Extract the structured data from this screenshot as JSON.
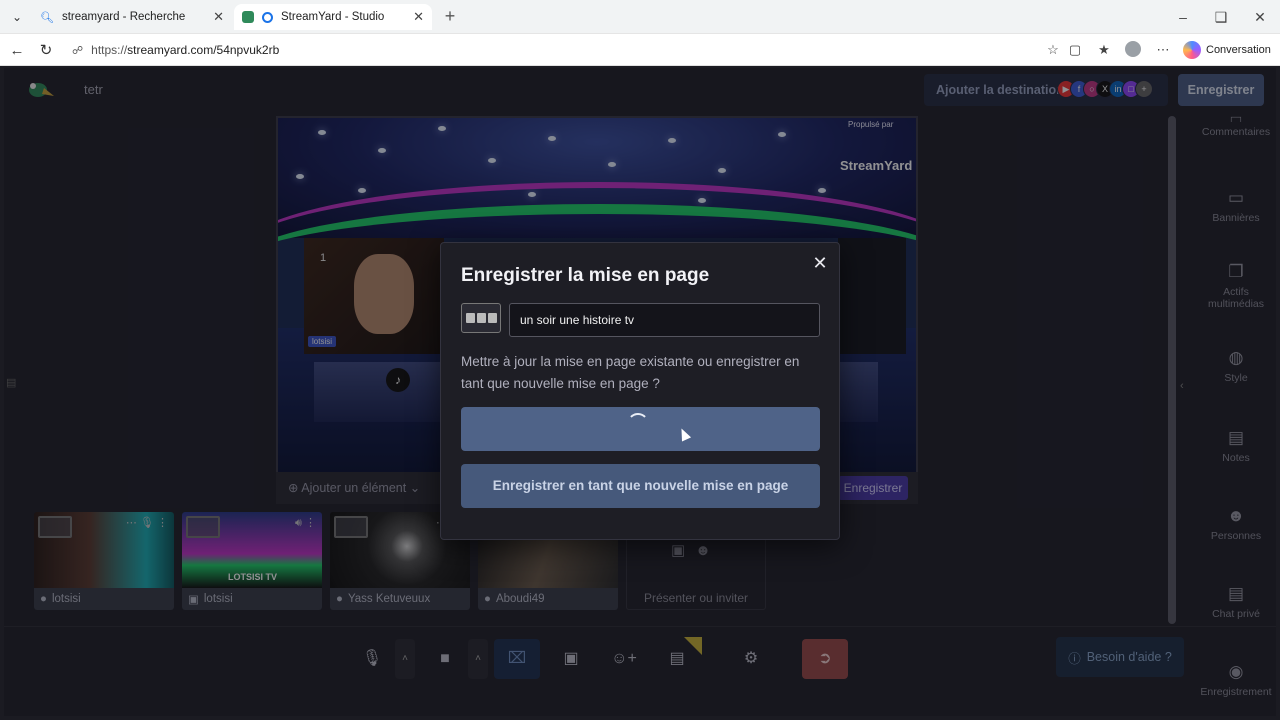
{
  "browser": {
    "tabs": [
      {
        "label": "streamyard - Recherche",
        "icon": "search-icon"
      },
      {
        "label": "StreamYard - Studio",
        "icon": "streamyard-favicon"
      }
    ],
    "url_prefix": "https://",
    "url_main": "streamyard.com/54npvuk2rb",
    "conversation_label": "Conversation"
  },
  "app": {
    "project_name": "tetr",
    "add_destination_label": "Ajouter la destination",
    "destination_icons": [
      "youtube-icon",
      "facebook-icon",
      "instagram-icon",
      "x-icon",
      "linkedin-icon",
      "twitch-icon",
      "plus-icon"
    ],
    "header_save_label": "Enregistrer",
    "stage": {
      "slot_number": "1",
      "name_tag": "lotsisi",
      "powered_by": "Propulsé par",
      "brand": "StreamYard"
    },
    "add_element_label": "Ajouter un élément",
    "stage_save_label": "Enregistrer",
    "thumbnails": [
      {
        "name": "lotsisi",
        "kind": "camera"
      },
      {
        "name": "lotsisi",
        "kind": "screen",
        "overlay_text": "LOTSISI TV"
      },
      {
        "name": "Yass Ketuveuux",
        "kind": "camera"
      },
      {
        "name": "Aboudi49",
        "kind": "camera"
      }
    ],
    "present_invite_label": "Présenter ou inviter",
    "sidebar": [
      {
        "label": "Commentaires",
        "icon": "comment-icon"
      },
      {
        "label": "Bannières",
        "icon": "banner-icon"
      },
      {
        "label": "Actifs multimédias",
        "icon": "media-icon"
      },
      {
        "label": "Style",
        "icon": "palette-icon"
      },
      {
        "label": "Notes",
        "icon": "notes-icon"
      },
      {
        "label": "Personnes",
        "icon": "people-icon"
      },
      {
        "label": "Chat privé",
        "icon": "chat-icon"
      },
      {
        "label": "Enregistrement",
        "icon": "record-icon"
      }
    ],
    "help_label": "Besoin d'aide ?"
  },
  "modal": {
    "title": "Enregistrer la mise en page",
    "layout_name": "un soir une histoire tv",
    "message": "Mettre à jour la mise en page existante ou enregistrer en tant que nouvelle mise en page ?",
    "save_as_new_label": "Enregistrer en tant que nouvelle mise en page"
  }
}
